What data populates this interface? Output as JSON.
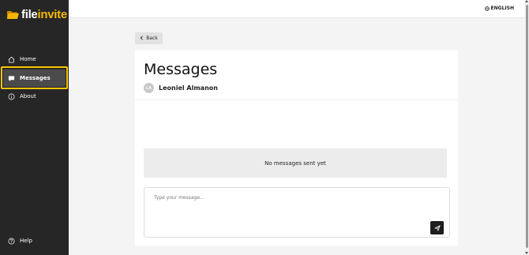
{
  "brand": {
    "name_part1": "file",
    "name_part2": "invite",
    "accent_color": "#f5b800"
  },
  "sidebar": {
    "items": [
      {
        "label": "Home",
        "icon": "home-icon"
      },
      {
        "label": "Messages",
        "icon": "message-icon",
        "active": true
      },
      {
        "label": "About",
        "icon": "info-icon"
      }
    ],
    "help_label": "Help"
  },
  "header": {
    "language": "ENGLISH"
  },
  "back_label": "Back",
  "page": {
    "title": "Messages",
    "recipient": {
      "initials": "LA",
      "name": "Leoniel Almanon"
    },
    "empty_text": "No messages sent yet",
    "composer": {
      "placeholder": "Type your message...",
      "value": ""
    }
  }
}
